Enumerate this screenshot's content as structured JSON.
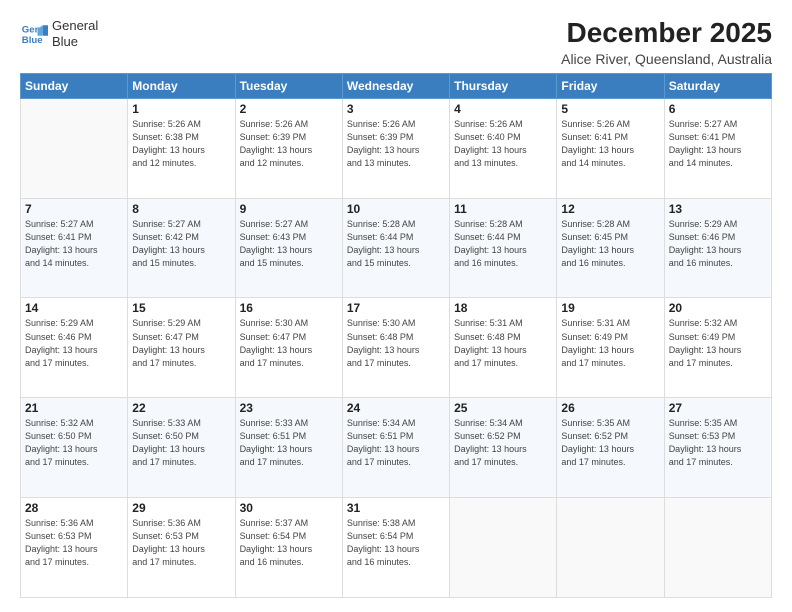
{
  "header": {
    "logo_line1": "General",
    "logo_line2": "Blue",
    "title": "December 2025",
    "subtitle": "Alice River, Queensland, Australia"
  },
  "weekdays": [
    "Sunday",
    "Monday",
    "Tuesday",
    "Wednesday",
    "Thursday",
    "Friday",
    "Saturday"
  ],
  "weeks": [
    [
      {
        "day": "",
        "info": ""
      },
      {
        "day": "1",
        "info": "Sunrise: 5:26 AM\nSunset: 6:38 PM\nDaylight: 13 hours\nand 12 minutes."
      },
      {
        "day": "2",
        "info": "Sunrise: 5:26 AM\nSunset: 6:39 PM\nDaylight: 13 hours\nand 12 minutes."
      },
      {
        "day": "3",
        "info": "Sunrise: 5:26 AM\nSunset: 6:39 PM\nDaylight: 13 hours\nand 13 minutes."
      },
      {
        "day": "4",
        "info": "Sunrise: 5:26 AM\nSunset: 6:40 PM\nDaylight: 13 hours\nand 13 minutes."
      },
      {
        "day": "5",
        "info": "Sunrise: 5:26 AM\nSunset: 6:41 PM\nDaylight: 13 hours\nand 14 minutes."
      },
      {
        "day": "6",
        "info": "Sunrise: 5:27 AM\nSunset: 6:41 PM\nDaylight: 13 hours\nand 14 minutes."
      }
    ],
    [
      {
        "day": "7",
        "info": "Sunrise: 5:27 AM\nSunset: 6:41 PM\nDaylight: 13 hours\nand 14 minutes."
      },
      {
        "day": "8",
        "info": "Sunrise: 5:27 AM\nSunset: 6:42 PM\nDaylight: 13 hours\nand 15 minutes."
      },
      {
        "day": "9",
        "info": "Sunrise: 5:27 AM\nSunset: 6:43 PM\nDaylight: 13 hours\nand 15 minutes."
      },
      {
        "day": "10",
        "info": "Sunrise: 5:28 AM\nSunset: 6:44 PM\nDaylight: 13 hours\nand 15 minutes."
      },
      {
        "day": "11",
        "info": "Sunrise: 5:28 AM\nSunset: 6:44 PM\nDaylight: 13 hours\nand 16 minutes."
      },
      {
        "day": "12",
        "info": "Sunrise: 5:28 AM\nSunset: 6:45 PM\nDaylight: 13 hours\nand 16 minutes."
      },
      {
        "day": "13",
        "info": "Sunrise: 5:29 AM\nSunset: 6:46 PM\nDaylight: 13 hours\nand 16 minutes."
      }
    ],
    [
      {
        "day": "14",
        "info": "Sunrise: 5:29 AM\nSunset: 6:46 PM\nDaylight: 13 hours\nand 17 minutes."
      },
      {
        "day": "15",
        "info": "Sunrise: 5:29 AM\nSunset: 6:47 PM\nDaylight: 13 hours\nand 17 minutes."
      },
      {
        "day": "16",
        "info": "Sunrise: 5:30 AM\nSunset: 6:47 PM\nDaylight: 13 hours\nand 17 minutes."
      },
      {
        "day": "17",
        "info": "Sunrise: 5:30 AM\nSunset: 6:48 PM\nDaylight: 13 hours\nand 17 minutes."
      },
      {
        "day": "18",
        "info": "Sunrise: 5:31 AM\nSunset: 6:48 PM\nDaylight: 13 hours\nand 17 minutes."
      },
      {
        "day": "19",
        "info": "Sunrise: 5:31 AM\nSunset: 6:49 PM\nDaylight: 13 hours\nand 17 minutes."
      },
      {
        "day": "20",
        "info": "Sunrise: 5:32 AM\nSunset: 6:49 PM\nDaylight: 13 hours\nand 17 minutes."
      }
    ],
    [
      {
        "day": "21",
        "info": "Sunrise: 5:32 AM\nSunset: 6:50 PM\nDaylight: 13 hours\nand 17 minutes."
      },
      {
        "day": "22",
        "info": "Sunrise: 5:33 AM\nSunset: 6:50 PM\nDaylight: 13 hours\nand 17 minutes."
      },
      {
        "day": "23",
        "info": "Sunrise: 5:33 AM\nSunset: 6:51 PM\nDaylight: 13 hours\nand 17 minutes."
      },
      {
        "day": "24",
        "info": "Sunrise: 5:34 AM\nSunset: 6:51 PM\nDaylight: 13 hours\nand 17 minutes."
      },
      {
        "day": "25",
        "info": "Sunrise: 5:34 AM\nSunset: 6:52 PM\nDaylight: 13 hours\nand 17 minutes."
      },
      {
        "day": "26",
        "info": "Sunrise: 5:35 AM\nSunset: 6:52 PM\nDaylight: 13 hours\nand 17 minutes."
      },
      {
        "day": "27",
        "info": "Sunrise: 5:35 AM\nSunset: 6:53 PM\nDaylight: 13 hours\nand 17 minutes."
      }
    ],
    [
      {
        "day": "28",
        "info": "Sunrise: 5:36 AM\nSunset: 6:53 PM\nDaylight: 13 hours\nand 17 minutes."
      },
      {
        "day": "29",
        "info": "Sunrise: 5:36 AM\nSunset: 6:53 PM\nDaylight: 13 hours\nand 17 minutes."
      },
      {
        "day": "30",
        "info": "Sunrise: 5:37 AM\nSunset: 6:54 PM\nDaylight: 13 hours\nand 16 minutes."
      },
      {
        "day": "31",
        "info": "Sunrise: 5:38 AM\nSunset: 6:54 PM\nDaylight: 13 hours\nand 16 minutes."
      },
      {
        "day": "",
        "info": ""
      },
      {
        "day": "",
        "info": ""
      },
      {
        "day": "",
        "info": ""
      }
    ]
  ]
}
